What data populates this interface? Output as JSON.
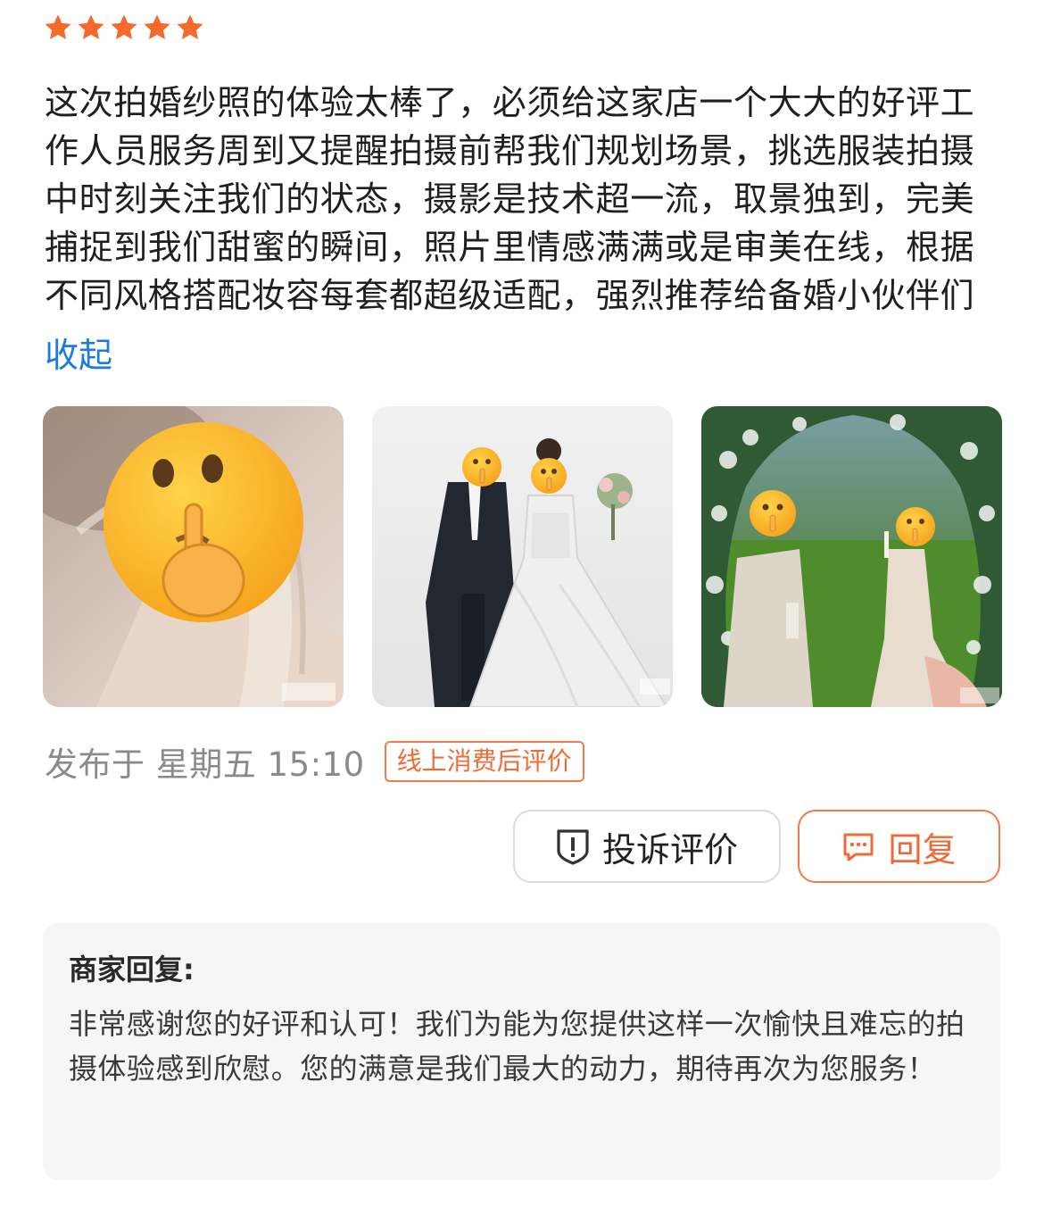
{
  "rating": {
    "stars": 5,
    "max": 5,
    "color": "#f56a2a"
  },
  "review": {
    "text": "这次拍婚纱照的体验太棒了，必须给这家店一个大大的好评工作人员服务周到又提醒拍摄前帮我们规划场景，挑选服装拍摄中时刻关注我们的状态，摄影是技术超一流，取景独到，完美捕捉到我们甜蜜的瞬间，照片里情感满满或是审美在线，根据不同风格搭配妆容每套都超级适配，强烈推荐给备婚小伙伴们",
    "collapse_label": "收起"
  },
  "photos": [
    {
      "icon": "shushing-face-emoji"
    },
    {
      "icon": "shushing-face-emoji"
    },
    {
      "icon": "shushing-face-emoji"
    }
  ],
  "meta": {
    "published": "发布于 星期五 15:10",
    "tag": "线上消费后评价"
  },
  "actions": {
    "complain_label": "投诉评价",
    "reply_label": "回复"
  },
  "merchant_reply": {
    "title": "商家回复:",
    "text": "非常感谢您的好评和认可！我们为能为您提供这样一次愉快且难忘的拍摄体验感到欣慰。您的满意是我们最大的动力，期待再次为您服务！"
  },
  "colors": {
    "accent": "#f06a36",
    "link": "#1c7be0",
    "muted": "#8a8a8a",
    "reply_bg": "#f6f6f6"
  }
}
